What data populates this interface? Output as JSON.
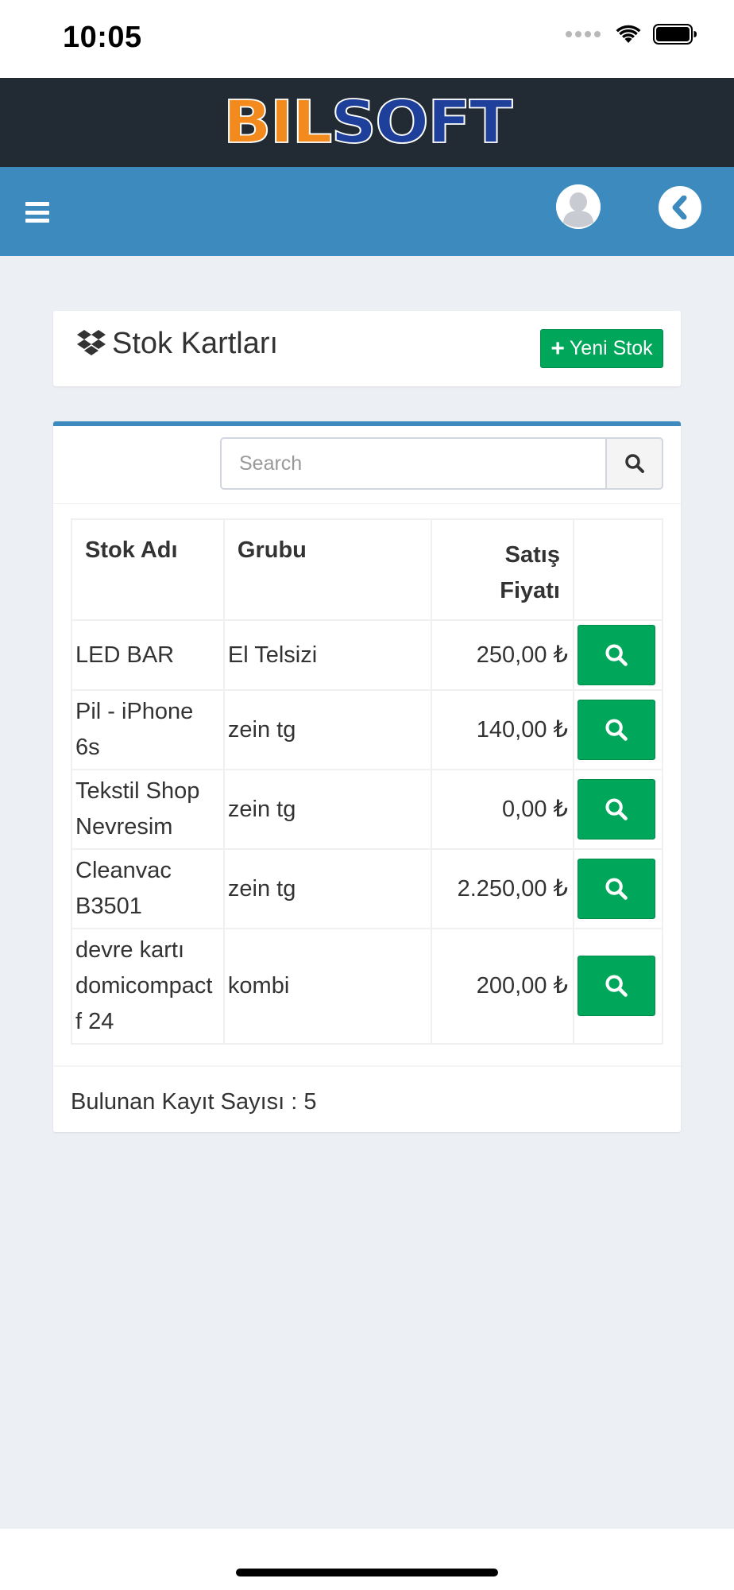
{
  "status_bar": {
    "time": "10:05"
  },
  "brand": {
    "logo_part1": "BIL",
    "logo_part2": "SOFT"
  },
  "page": {
    "title": "Stok Kartları",
    "new_button_label": "Yeni Stok"
  },
  "search": {
    "placeholder": "Search"
  },
  "table": {
    "headers": {
      "name": "Stok Adı",
      "group": "Grubu",
      "price_line1": "Satış",
      "price_line2": "Fiyatı"
    },
    "rows": [
      {
        "name": "LED BAR",
        "group": "El Telsizi",
        "price": "250,00 ₺"
      },
      {
        "name": "Pil - iPhone 6s",
        "group": "zein tg",
        "price": "140,00 ₺"
      },
      {
        "name": "Tekstil Shop Nevresim",
        "group": "zein tg",
        "price": "0,00 ₺"
      },
      {
        "name": "Cleanvac B3501",
        "group": "zein tg",
        "price": "2.250,00 ₺"
      },
      {
        "name": "devre kartı domicompact f 24",
        "group": "kombi",
        "price": "200,00 ₺"
      }
    ]
  },
  "footer": {
    "record_count_text": "Bulunan Kayıt Sayısı : 5"
  },
  "icons": {
    "menu": "hamburger-icon",
    "user": "avatar-icon",
    "back": "chevron-left-icon",
    "header": "dropbox-icon",
    "new": "plus-icon",
    "search": "search-icon"
  },
  "colors": {
    "logo_bar": "#222b33",
    "nav_bar": "#3d8abf",
    "success": "#00a65a",
    "page_bg": "#eceff4",
    "logo_orange": "#f28a1e",
    "logo_blue": "#1e3f9a"
  }
}
